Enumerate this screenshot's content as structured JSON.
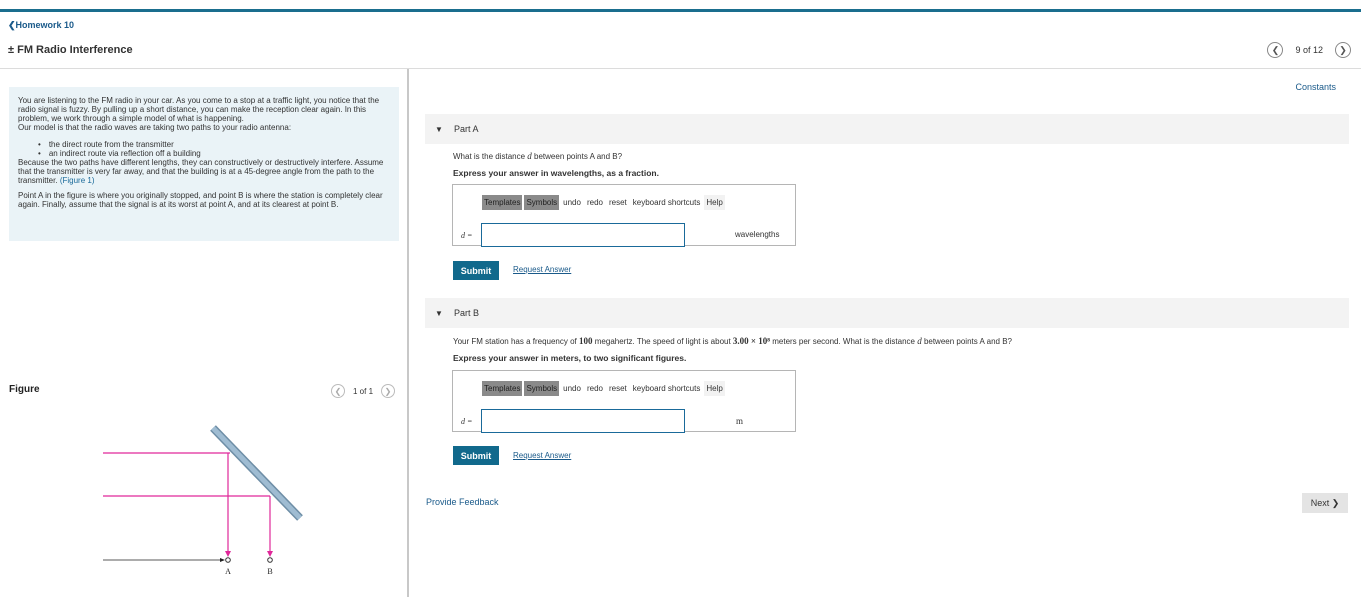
{
  "header": {
    "back_link": "❮Homework 10",
    "title": "± FM Radio Interference",
    "pager_prev": "❮",
    "pager_text": "9 of 12",
    "pager_next": "❯"
  },
  "intro": {
    "p1": "You are listening to the FM radio in your car. As you come to a stop at a traffic light, you notice that the radio signal is fuzzy. By pulling up a short distance, you can make the reception clear again. In this problem, we work through a simple model of what is happening.",
    "p2": "Our model is that the radio waves are taking two paths to your radio antenna:",
    "bullets": [
      "the direct route from the transmitter",
      "an indirect route via reflection off a building"
    ],
    "p3": "Because the two paths have different lengths, they can constructively or destructively interfere. Assume that the transmitter is very far away, and that the building is at a 45-degree angle from the path to the transmitter.",
    "figure_link": "(Figure 1)",
    "p4": "Point A in the figure is where you originally stopped, and point B is where the station is completely clear again. Finally, assume that the signal is at its worst at point A, and at its clearest at point B."
  },
  "figure": {
    "label": "Figure",
    "pager_text": "1 of 1",
    "point_a": "A",
    "point_b": "B",
    "beam_color": "#e0289a",
    "building_color": "#8faec6"
  },
  "constants_link": "Constants",
  "part_a": {
    "label": "Part A",
    "question_pre": "What is the distance",
    "question_var": "d",
    "question_post": "between points A and B?",
    "instruction": "Express your answer in wavelengths, as a fraction.",
    "toolbar": {
      "templates": "Templates",
      "symbols": "Symbols",
      "undo": "undo",
      "redo": "redo",
      "reset": "reset",
      "shortcuts": "keyboard shortcuts",
      "help": "Help"
    },
    "var_label": "d =",
    "input_value": "",
    "unit": "wavelengths",
    "submit": "Submit",
    "request": "Request Answer"
  },
  "part_b": {
    "label": "Part B",
    "question_pre": "Your FM station has a frequency of",
    "frequency": "100",
    "question_mid": "megahertz. The speed of light is about",
    "speed": "3.00 × 10⁸",
    "question_mid2": "meters per second. What is the distance",
    "question_var": "d",
    "question_post": "between points A and B?",
    "instruction": "Express your answer in meters, to two significant figures.",
    "toolbar": {
      "templates": "Templates",
      "symbols": "Symbols",
      "undo": "undo",
      "redo": "redo",
      "reset": "reset",
      "shortcuts": "keyboard shortcuts",
      "help": "Help"
    },
    "var_label": "d =",
    "input_value": "",
    "unit": "m",
    "submit": "Submit",
    "request": "Request Answer"
  },
  "footer": {
    "feedback": "Provide Feedback",
    "next": "Next ❯"
  }
}
